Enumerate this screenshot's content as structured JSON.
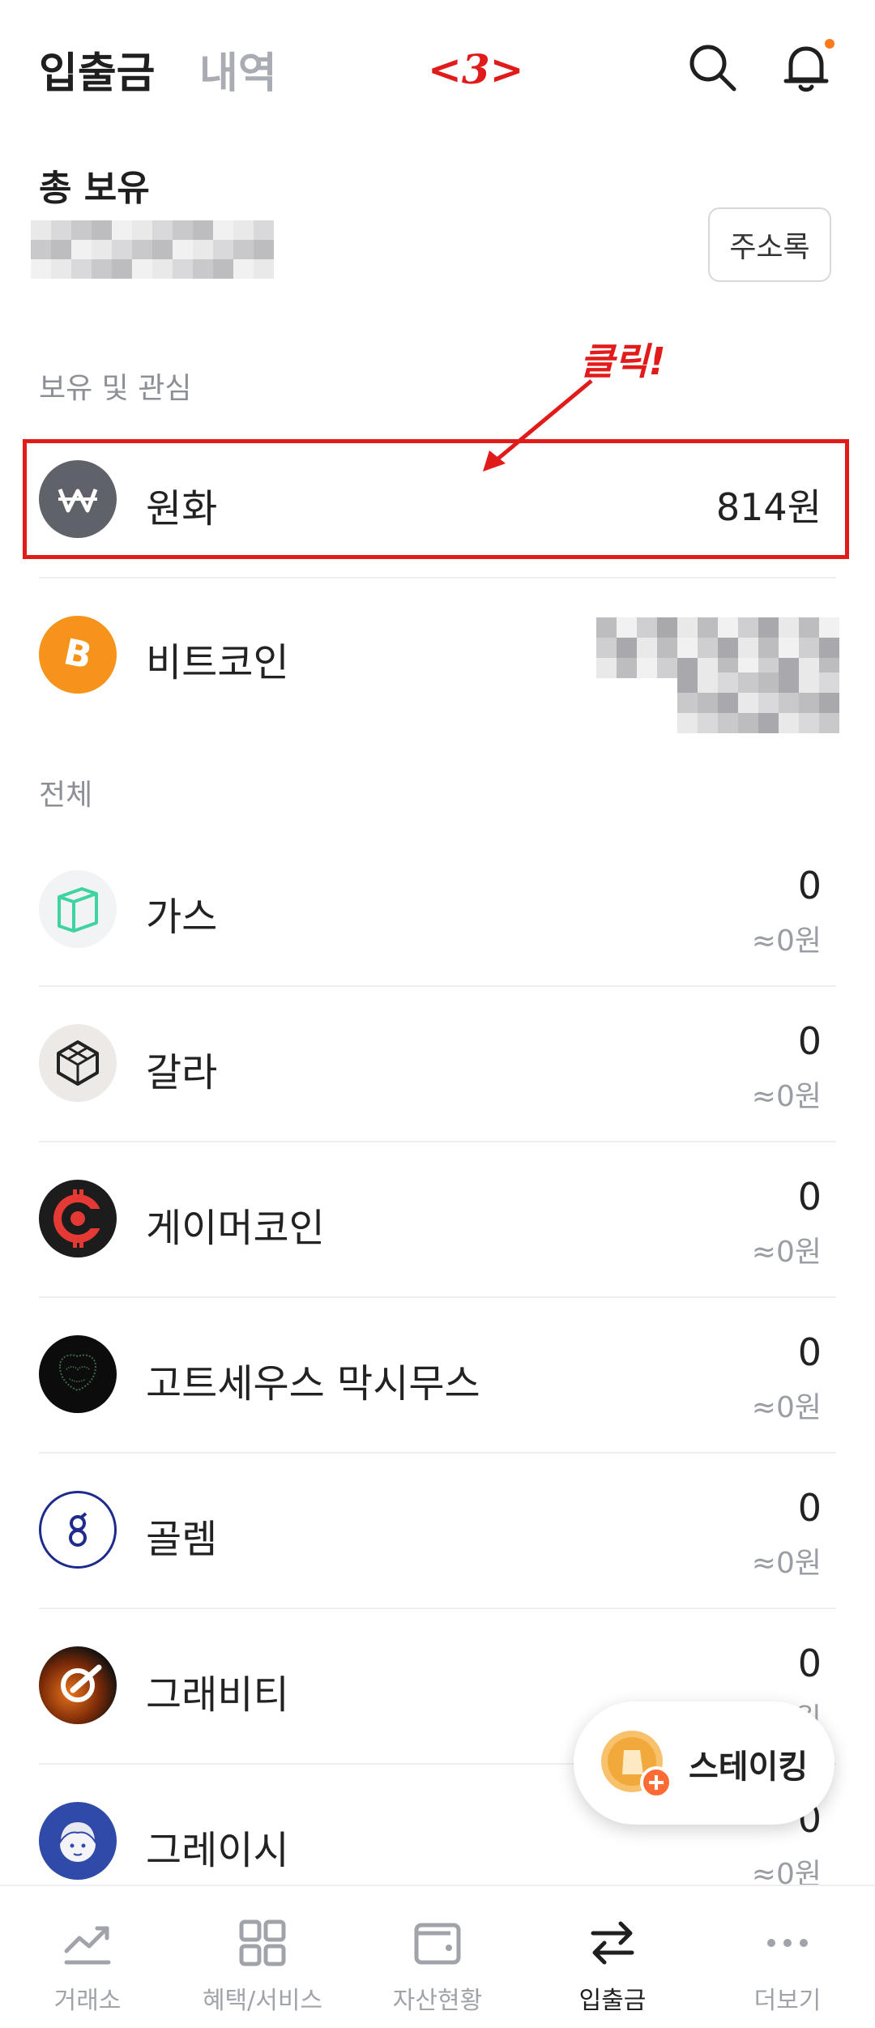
{
  "header": {
    "tab_active": "입출금",
    "tab_inactive": "내역",
    "step_label": "<3>",
    "icons": [
      "search-icon",
      "bell-icon"
    ],
    "notification_dot_color": "#ff7a1a"
  },
  "total": {
    "label": "총 보유",
    "address_book_label": "주소록"
  },
  "annotation": {
    "click_label": "클릭!",
    "color": "#e11a1a"
  },
  "holdings_section": {
    "label": "보유 및 관심",
    "items": [
      {
        "name": "원화",
        "amount": "814원",
        "icon": "won-icon"
      },
      {
        "name": "비트코인",
        "icon": "bitcoin-icon"
      }
    ]
  },
  "all_section": {
    "label": "전체",
    "items": [
      {
        "name": "가스",
        "amount": "0",
        "krw": "≈0원",
        "icon": "gas-icon"
      },
      {
        "name": "갈라",
        "amount": "0",
        "krw": "≈0원",
        "icon": "gala-icon"
      },
      {
        "name": "게이머코인",
        "amount": "0",
        "krw": "≈0원",
        "icon": "gamercoin-icon"
      },
      {
        "name": "고트세우스 막시무스",
        "amount": "0",
        "krw": "≈0원",
        "icon": "goatseus-icon"
      },
      {
        "name": "골렘",
        "amount": "0",
        "krw": "≈0원",
        "icon": "golem-icon"
      },
      {
        "name": "그래비티",
        "amount": "0",
        "krw": "≈0원",
        "icon": "gravity-icon"
      },
      {
        "name": "그레이시",
        "amount": "0",
        "krw": "≈0원",
        "icon": "gracy-icon"
      }
    ]
  },
  "staking_button": {
    "label": "스테이킹",
    "icon": "staking-coin-icon"
  },
  "bottom_nav": {
    "items": [
      {
        "label": "거래소",
        "icon": "chart-icon"
      },
      {
        "label": "혜택/서비스",
        "icon": "grid-icon"
      },
      {
        "label": "자산현황",
        "icon": "wallet-icon"
      },
      {
        "label": "입출금",
        "icon": "transfer-icon",
        "active": true
      },
      {
        "label": "더보기",
        "icon": "more-icon"
      }
    ]
  }
}
